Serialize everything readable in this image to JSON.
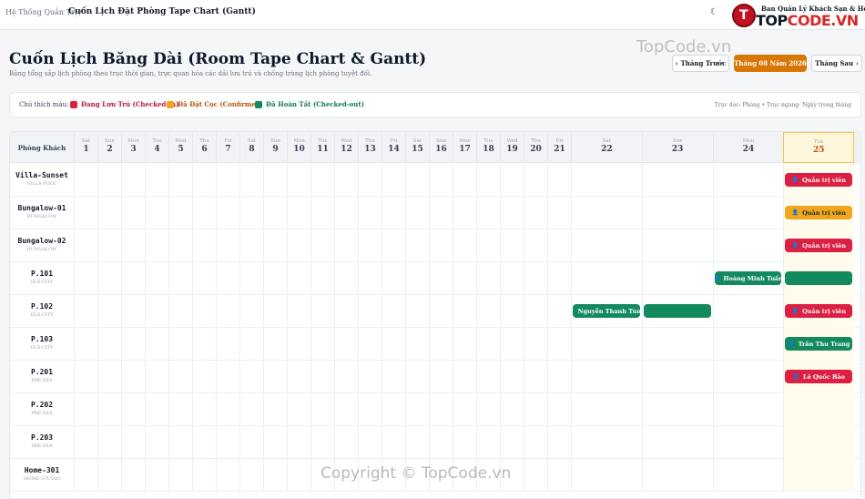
{
  "breadcrumb": {
    "root": "Hệ Thống Quản Trị /",
    "current": "Cuốn Lịch Đặt Phòng Tape Chart (Gantt)"
  },
  "brand": {
    "subtitle": "Ban Quản Lý Khách Sạn & Homestay",
    "name_part1": "TOP",
    "name_part2": "CODE.VN",
    "logo_glyph": "T"
  },
  "header": {
    "title": "Cuốn Lịch Băng Dài (Room Tape Chart & Gantt)",
    "subtitle": "Bảng tổng sắp lịch phòng theo trục thời gian, trực quan hóa các dải lưu trú và chống trùng lịch phòng tuyệt đối.",
    "prev_label": "Tháng Trước",
    "month_label": "Tháng 08 Năm 2026",
    "next_label": "Tháng Sau"
  },
  "legend": {
    "label": "Chú thích màu:",
    "items": [
      {
        "label": "Đang Lưu Trú (Checked-in)",
        "color": "#dc2044"
      },
      {
        "label": "Đã Đặt Cọc (Confirmed)",
        "color": "#f0a71b"
      },
      {
        "label": "Đã Hoàn Tất (Checked-out)",
        "color": "#138a5e"
      }
    ],
    "hint": "Trục dọc: Phòng • Trục ngang: Ngày trong tháng"
  },
  "grid": {
    "room_header": "Phòng Khách",
    "days": [
      {
        "dw": "Sat",
        "dn": "1"
      },
      {
        "dw": "Sun",
        "dn": "2"
      },
      {
        "dw": "Mon",
        "dn": "3"
      },
      {
        "dw": "Tue",
        "dn": "4"
      },
      {
        "dw": "Wed",
        "dn": "5"
      },
      {
        "dw": "Thu",
        "dn": "6"
      },
      {
        "dw": "Fri",
        "dn": "7"
      },
      {
        "dw": "Sat",
        "dn": "8"
      },
      {
        "dw": "Sun",
        "dn": "9"
      },
      {
        "dw": "Mon",
        "dn": "10"
      },
      {
        "dw": "Tue",
        "dn": "11"
      },
      {
        "dw": "Wed",
        "dn": "12"
      },
      {
        "dw": "Thu",
        "dn": "13"
      },
      {
        "dw": "Fri",
        "dn": "14"
      },
      {
        "dw": "Sat",
        "dn": "15"
      },
      {
        "dw": "Sun",
        "dn": "16"
      },
      {
        "dw": "Mon",
        "dn": "17"
      },
      {
        "dw": "Tue",
        "dn": "18"
      },
      {
        "dw": "Wed",
        "dn": "19"
      },
      {
        "dw": "Thu",
        "dn": "20"
      },
      {
        "dw": "Fri",
        "dn": "21"
      },
      {
        "dw": "Sat",
        "dn": "22"
      },
      {
        "dw": "Sun",
        "dn": "23"
      },
      {
        "dw": "Mon",
        "dn": "24"
      },
      {
        "dw": "Tue",
        "dn": "25"
      }
    ],
    "today_index": 24,
    "rooms": [
      {
        "name": "Villa-Sunset",
        "type": "VILLA-POOL"
      },
      {
        "name": "Bungalow-01",
        "type": "BUNGALOW"
      },
      {
        "name": "Bungalow-02",
        "type": "BUNGALOW"
      },
      {
        "name": "P.101",
        "type": "DLX-CITY"
      },
      {
        "name": "P.102",
        "type": "DLX-CITY"
      },
      {
        "name": "P.103",
        "type": "DLX-CITY"
      },
      {
        "name": "P.201",
        "type": "PRE-SEA"
      },
      {
        "name": "P.202",
        "type": "PRE-SEA"
      },
      {
        "name": "P.203",
        "type": "PRE-SEA"
      },
      {
        "name": "Home-301",
        "type": "HOME-STUDIO"
      }
    ],
    "bookings": [
      {
        "room": 0,
        "start": 24,
        "end": 24,
        "status": "red",
        "guest": "Quản trị viên"
      },
      {
        "room": 1,
        "start": 24,
        "end": 24,
        "status": "yel",
        "guest": "Quản trị viên"
      },
      {
        "room": 2,
        "start": 24,
        "end": 24,
        "status": "red",
        "guest": "Quản trị viên"
      },
      {
        "room": 3,
        "start": 23,
        "end": 23,
        "status": "grn",
        "guest": "Hoàng Minh Tuấn"
      },
      {
        "room": 3,
        "start": 24,
        "end": 24,
        "status": "grn",
        "guest": ""
      },
      {
        "room": 4,
        "start": 21,
        "end": 21,
        "status": "grn",
        "guest": "Nguyễn Thanh Tùng"
      },
      {
        "room": 4,
        "start": 22,
        "end": 22,
        "status": "grn",
        "guest": ""
      },
      {
        "room": 4,
        "start": 24,
        "end": 24,
        "status": "red",
        "guest": "Quản trị viên"
      },
      {
        "room": 5,
        "start": 24,
        "end": 24,
        "status": "grn",
        "guest": "Trần Thu Trang"
      },
      {
        "room": 6,
        "start": 24,
        "end": 24,
        "status": "red",
        "guest": "Lê Quốc Bảo"
      }
    ]
  },
  "watermarks": {
    "top": "TopCode.vn",
    "bottom": "Copyright © TopCode.vn"
  }
}
